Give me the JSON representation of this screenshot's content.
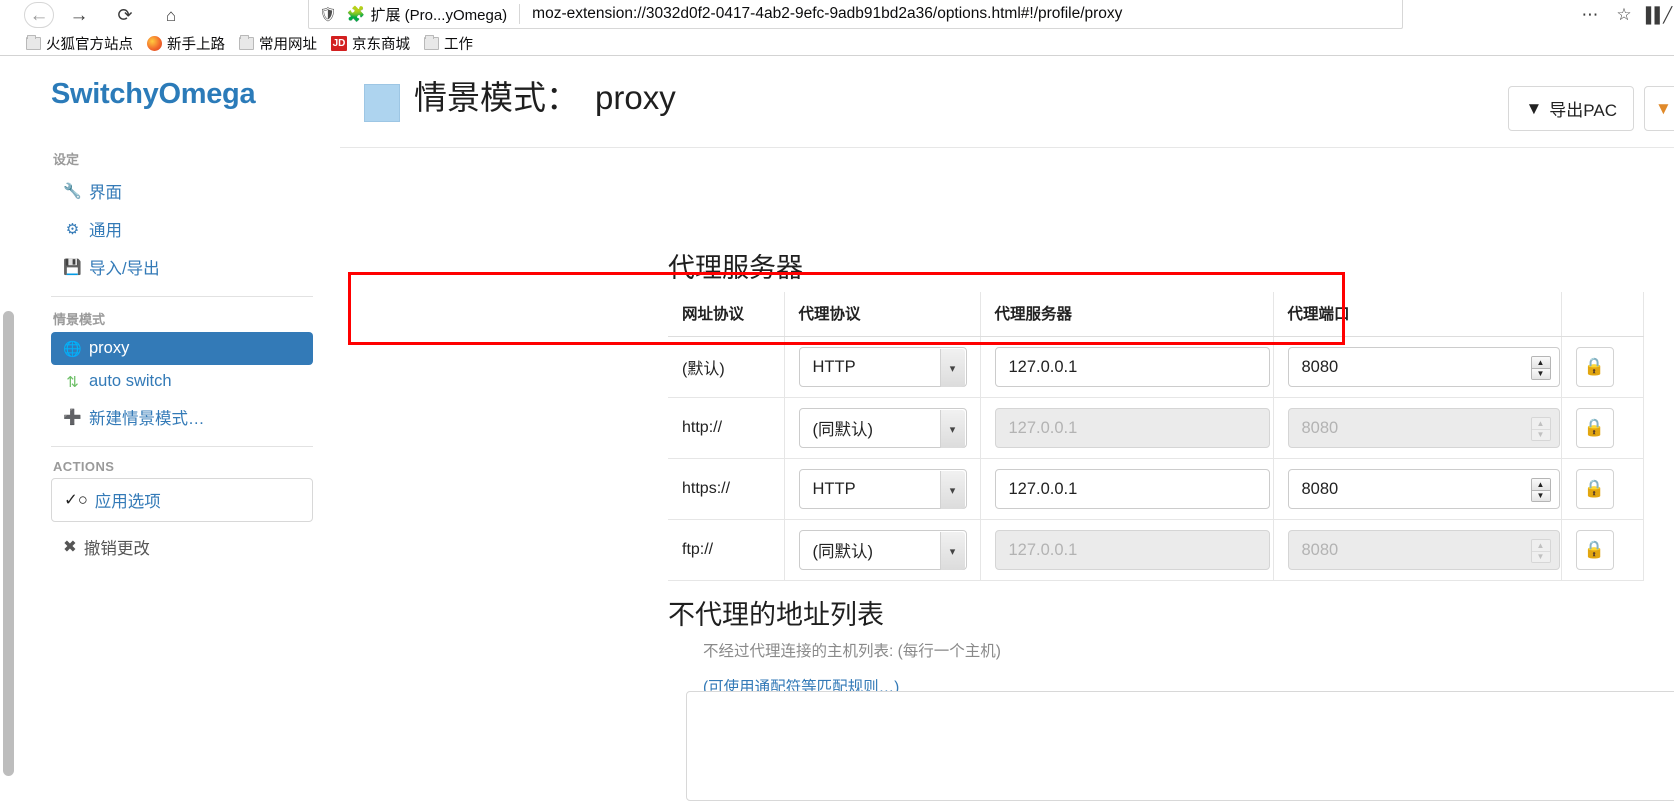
{
  "browser": {
    "nav": {
      "back_icon": "arrow-left-icon",
      "forward_icon": "arrow-right-icon",
      "reload_icon": "reload-icon",
      "home_icon": "home-icon"
    },
    "urlbar": {
      "shield_icon": "shield-icon",
      "extension_icon": "puzzle-piece-icon",
      "extension_label": "扩展 (Pro...yOmega)",
      "url": "moz-extension://3032d0f2-0417-4ab2-9efc-9adb91bd2a36/options.html#!/profile/proxy",
      "overflow_icon": "ellipsis-icon",
      "bookmark_star_icon": "star-icon"
    },
    "chrome_right": {
      "library_icon": "library-icon"
    },
    "bookmarks": [
      {
        "label": "火狐官方站点",
        "icon": "folder-icon"
      },
      {
        "label": "新手上路",
        "icon": "firefox-icon"
      },
      {
        "label": "常用网址",
        "icon": "folder-icon"
      },
      {
        "label": "京东商城",
        "icon": "jd-icon",
        "badge": "JD"
      },
      {
        "label": "工作",
        "icon": "folder-icon"
      }
    ]
  },
  "sidebar": {
    "brand": "SwitchyOmega",
    "settings_heading": "设定",
    "settings_items": [
      {
        "label": "界面",
        "icon": "wrench-icon"
      },
      {
        "label": "通用",
        "icon": "gear-icon"
      },
      {
        "label": "导入/导出",
        "icon": "save-icon"
      }
    ],
    "profiles_heading": "情景模式",
    "profile_items": [
      {
        "label": "proxy",
        "icon": "globe-icon",
        "active": true
      },
      {
        "label": "auto switch",
        "icon": "switch-icon",
        "active": false
      },
      {
        "label": "新建情景模式…",
        "icon": "plus-icon",
        "active": false
      }
    ],
    "actions_heading": "ACTIONS",
    "apply_label": "应用选项",
    "apply_icon": "check-circle-icon",
    "revert_label": "撤销更改",
    "revert_icon": "x-circle-icon"
  },
  "header": {
    "title_prefix": "情景模式：",
    "profile_name": "proxy",
    "swatch_color": "#aed4ef",
    "buttons": [
      {
        "label": "导出PAC",
        "icon": "download-circle-icon"
      },
      {
        "label": "",
        "icon": "download-circle-icon"
      }
    ]
  },
  "proxy_section": {
    "title": "代理服务器",
    "columns": [
      "网址协议",
      "代理协议",
      "代理服务器",
      "代理端口",
      ""
    ],
    "rows": [
      {
        "scheme": "(默认)",
        "protocol": "HTTP",
        "server": "127.0.0.1",
        "port": "8080",
        "disabled": false,
        "highlighted": true,
        "lock_icon": "lock-icon"
      },
      {
        "scheme": "http://",
        "protocol": "(同默认)",
        "server": "127.0.0.1",
        "port": "8080",
        "disabled": true,
        "highlighted": false,
        "lock_icon": "lock-icon"
      },
      {
        "scheme": "https://",
        "protocol": "HTTP",
        "server": "127.0.0.1",
        "port": "8080",
        "disabled": false,
        "highlighted": false,
        "lock_icon": "lock-icon"
      },
      {
        "scheme": "ftp://",
        "protocol": "(同默认)",
        "server": "127.0.0.1",
        "port": "8080",
        "disabled": true,
        "highlighted": false,
        "lock_icon": "lock-icon"
      }
    ]
  },
  "bypass_section": {
    "title": "不代理的地址列表",
    "help": "不经过代理连接的主机列表: (每行一个主机)",
    "link": "(可使用通配符等匹配规则…)",
    "textarea_value": ""
  }
}
